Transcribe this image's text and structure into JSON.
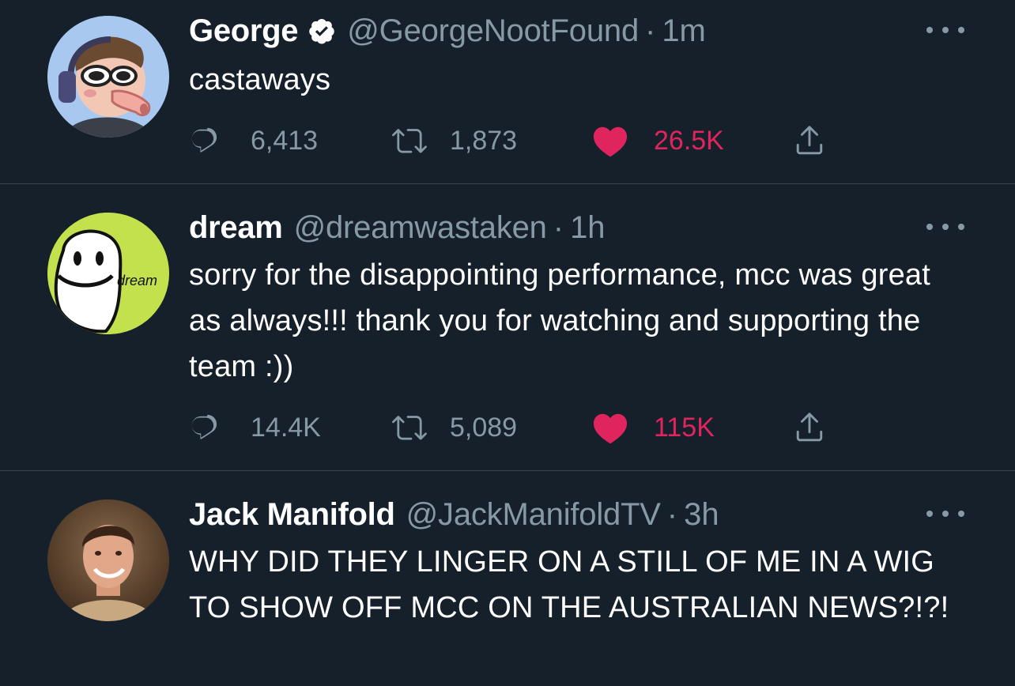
{
  "colors": {
    "background": "#15202b",
    "text_primary": "#ffffff",
    "text_secondary": "#8899a6",
    "like_active": "#e0245e",
    "verified": "#ffffff",
    "divider": "#38444d"
  },
  "tweets": [
    {
      "name": "George",
      "verified": true,
      "handle": "@GeorgeNootFound",
      "separator": "·",
      "time": "1m",
      "text": "castaways",
      "replies": "6,413",
      "retweets": "1,873",
      "likes": "26.5K",
      "liked": true,
      "avatar_icon": "cartoon-avatar-sunglasses-headphones"
    },
    {
      "name": "dream",
      "verified": false,
      "handle": "@dreamwastaken",
      "separator": "·",
      "time": "1h",
      "text": "sorry for the disappointing performance, mcc was great as always!!! thank you for watching and supporting the team :))",
      "replies": "14.4K",
      "retweets": "5,089",
      "likes": "115K",
      "liked": true,
      "avatar_icon": "smiley-mask-avatar",
      "avatar_text": "dream"
    },
    {
      "name": "Jack Manifold",
      "verified": false,
      "handle": "@JackManifoldTV",
      "separator": "·",
      "time": "3h",
      "text": "WHY DID THEY LINGER ON A STILL OF ME IN A WIG TO SHOW OFF MCC ON THE AUSTRALIAN NEWS?!?!",
      "avatar_icon": "photo-avatar"
    }
  ],
  "icons": {
    "reply": "reply-icon",
    "retweet": "retweet-icon",
    "like": "heart-icon",
    "share": "share-icon",
    "more": "more-icon",
    "verified": "verified-badge-icon"
  }
}
